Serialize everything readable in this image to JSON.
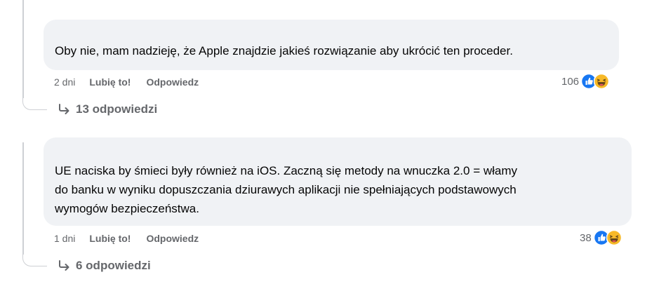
{
  "comments": [
    {
      "text_lines": [
        "Oby nie, mam nadzieję, że Apple znajdzie jakieś rozwiązanie aby ukrócić ten proceder."
      ],
      "time": "2 dni",
      "like_label": "Lubię to!",
      "reply_label": "Odpowiedz",
      "reaction_count": "106",
      "reactions": [
        "like-icon",
        "haha-icon"
      ],
      "replies_label": "13 odpowiedzi"
    },
    {
      "text_lines": [
        "UE naciska by śmieci były również na iOS. Zaczną się metody na wnuczka 2.0 = włamy",
        "do banku w wyniku dopuszczania dziurawych aplikacji nie spełniających podstawowych",
        "wymogów bezpieczeństwa."
      ],
      "time": "1 dni",
      "like_label": "Lubię to!",
      "reply_label": "Odpowiedz",
      "reaction_count": "38",
      "reactions": [
        "like-icon",
        "haha-icon"
      ],
      "replies_label": "6 odpowiedzi"
    }
  ],
  "colors": {
    "bubble": "#f0f2f5",
    "text": "#050505",
    "secondary": "#65676b",
    "like_blue": "#1877f2",
    "haha_yellow": "#f7b928",
    "thread_line": "#ced0d4"
  }
}
